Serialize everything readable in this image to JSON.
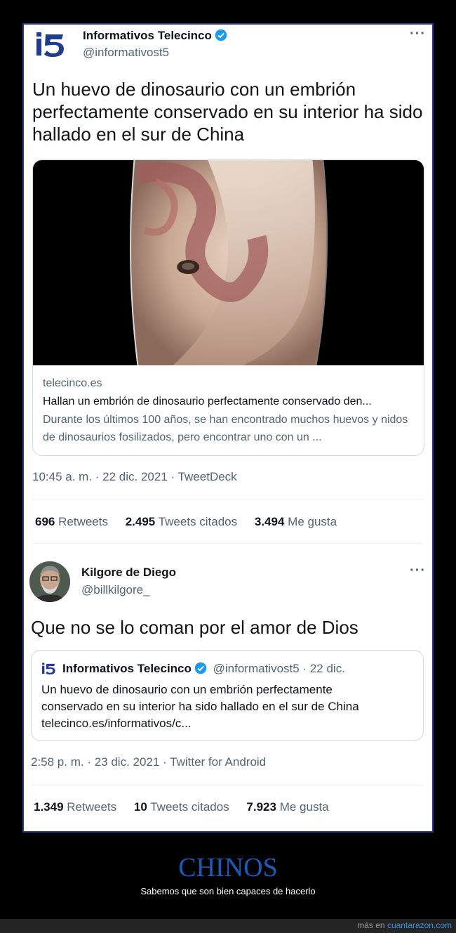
{
  "tweet1": {
    "account_name": "Informativos Telecinco",
    "handle": "@informativost5",
    "more_icon": "more-dots-icon",
    "text": "Un huevo de dinosaurio con un embrión perfectamente conservado en su interior ha sido hallado en el sur de China",
    "card": {
      "domain": "telecinco.es",
      "title": "Hallan un embrión de dinosaurio perfectamente conservado den...",
      "description": "Durante los últimos 100 años, se han encontrado muchos huevos y nidos de dinosaurios fosilizados, pero encontrar uno con un ..."
    },
    "meta": "10:45 a. m. · 22 dic. 2021 · TweetDeck",
    "stats": {
      "retweets_count": "696",
      "retweets_label": "Retweets",
      "quotes_count": "2.495",
      "quotes_label": "Tweets citados",
      "likes_count": "3.494",
      "likes_label": "Me gusta"
    }
  },
  "tweet2": {
    "account_name": "Kilgore de Diego",
    "handle": "@billkilgore_",
    "text": "Que no se lo coman por el amor de Dios",
    "quote": {
      "account_name": "Informativos Telecinco",
      "handle_date": "@informativost5 · 22 dic.",
      "text": "Un huevo de dinosaurio con un embrión perfectamente conservado en su interior ha sido hallado en el sur de China telecinco.es/informativos/c..."
    },
    "meta": "2:58 p. m. · 23 dic. 2021 · Twitter for Android",
    "stats": {
      "retweets_count": "1.349",
      "retweets_label": "Retweets",
      "quotes_count": "10",
      "quotes_label": "Tweets citados",
      "likes_count": "7.923",
      "likes_label": "Me gusta"
    }
  },
  "caption": {
    "title": "CHINOS",
    "subtitle": "Sabemos que son bien capaces de hacerlo"
  },
  "footer": {
    "prefix": "más en",
    "site": "cuantarazon.com"
  },
  "colors": {
    "verified": "#1d9bf0",
    "caption_title": "#1a5bb8",
    "frame_border": "#2a3b8f"
  }
}
